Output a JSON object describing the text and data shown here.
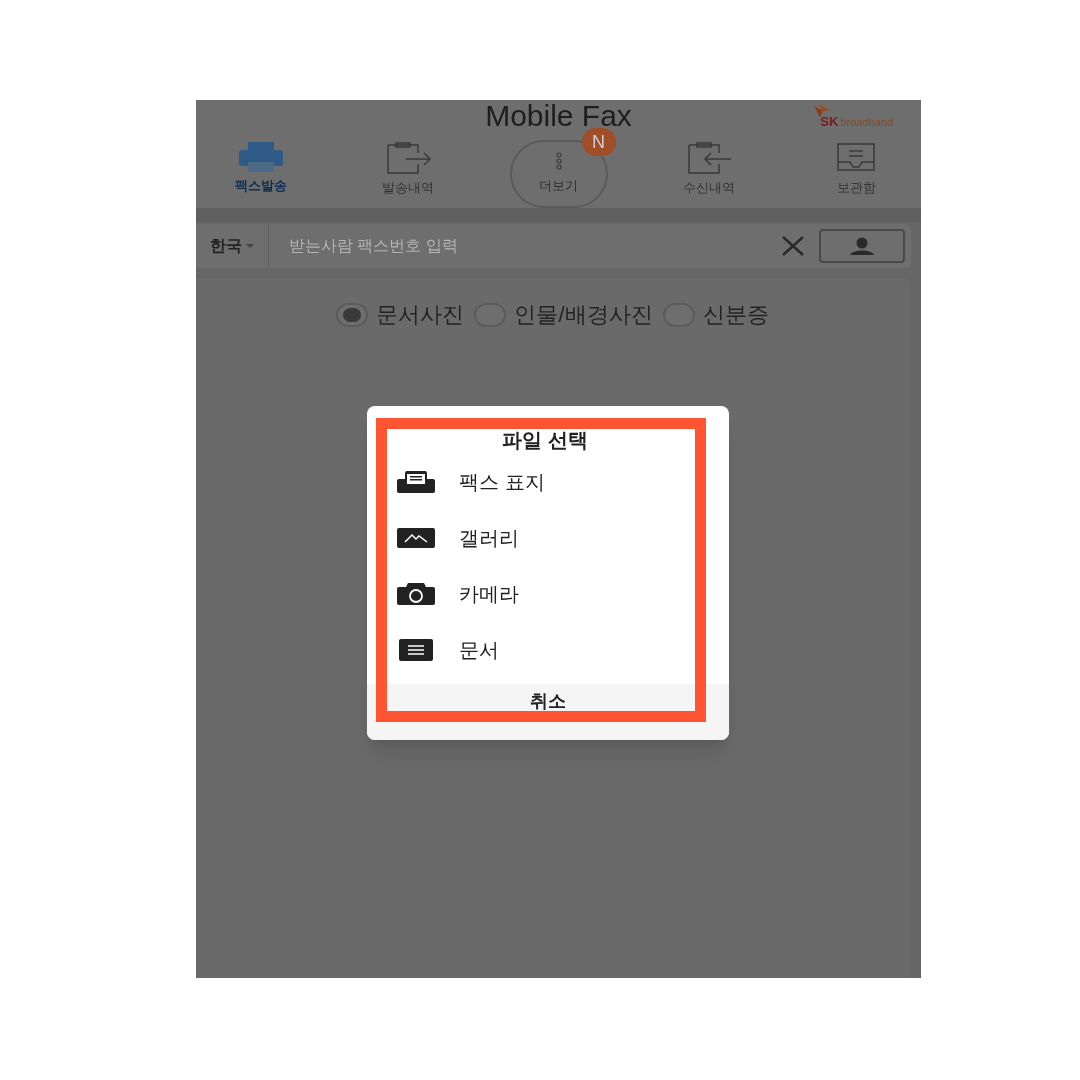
{
  "header": {
    "title": "Mobile Fax",
    "logo_sk": "SK",
    "logo_text": "broadband"
  },
  "tabs": [
    {
      "label": "팩스발송",
      "kind": "fax",
      "selected": true
    },
    {
      "label": "발송내역",
      "kind": "sent",
      "selected": false
    },
    {
      "label": "더보기",
      "kind": "more",
      "selected": false,
      "badge": "N"
    },
    {
      "label": "수신내역",
      "kind": "received",
      "selected": false
    },
    {
      "label": "보관함",
      "kind": "archive",
      "selected": false
    }
  ],
  "recipient": {
    "country": "한국",
    "placeholder": "받는사람 팩스번호 입력"
  },
  "photo_types": [
    {
      "label": "문서사진",
      "selected": true
    },
    {
      "label": "인물/배경사진",
      "selected": false
    },
    {
      "label": "신분증",
      "selected": false
    }
  ],
  "dialog": {
    "title": "파일 선택",
    "items": [
      {
        "label": "팩스 표지",
        "kind": "fax"
      },
      {
        "label": "갤러리",
        "kind": "gallery"
      },
      {
        "label": "카메라",
        "kind": "camera"
      },
      {
        "label": "문서",
        "kind": "document"
      }
    ],
    "cancel": "취소"
  }
}
